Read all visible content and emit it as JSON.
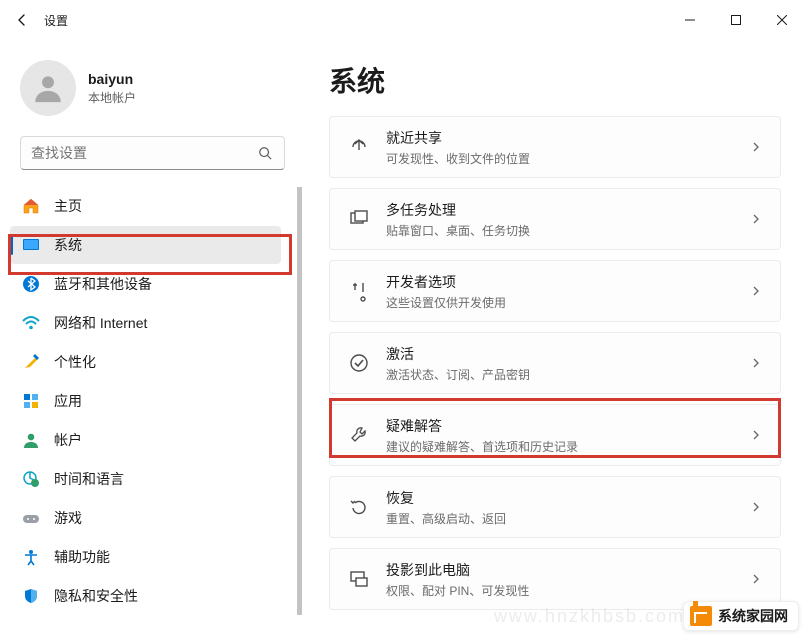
{
  "window": {
    "title": "设置"
  },
  "user": {
    "name": "baiyun",
    "subtitle": "本地帐户"
  },
  "search": {
    "placeholder": "查找设置"
  },
  "nav": {
    "items": [
      {
        "label": "主页"
      },
      {
        "label": "系统"
      },
      {
        "label": "蓝牙和其他设备"
      },
      {
        "label": "网络和 Internet"
      },
      {
        "label": "个性化"
      },
      {
        "label": "应用"
      },
      {
        "label": "帐户"
      },
      {
        "label": "时间和语言"
      },
      {
        "label": "游戏"
      },
      {
        "label": "辅助功能"
      },
      {
        "label": "隐私和安全性"
      }
    ]
  },
  "main": {
    "title": "系统",
    "cards": [
      {
        "title": "就近共享",
        "sub": "可发现性、收到文件的位置"
      },
      {
        "title": "多任务处理",
        "sub": "贴靠窗口、桌面、任务切换"
      },
      {
        "title": "开发者选项",
        "sub": "这些设置仅供开发使用"
      },
      {
        "title": "激活",
        "sub": "激活状态、订阅、产品密钥"
      },
      {
        "title": "疑难解答",
        "sub": "建议的疑难解答、首选项和历史记录"
      },
      {
        "title": "恢复",
        "sub": "重置、高级启动、返回"
      },
      {
        "title": "投影到此电脑",
        "sub": "权限、配对 PIN、可发现性"
      }
    ]
  },
  "watermark": "www.hnzkhbsb.com",
  "brand": "系统家园网"
}
